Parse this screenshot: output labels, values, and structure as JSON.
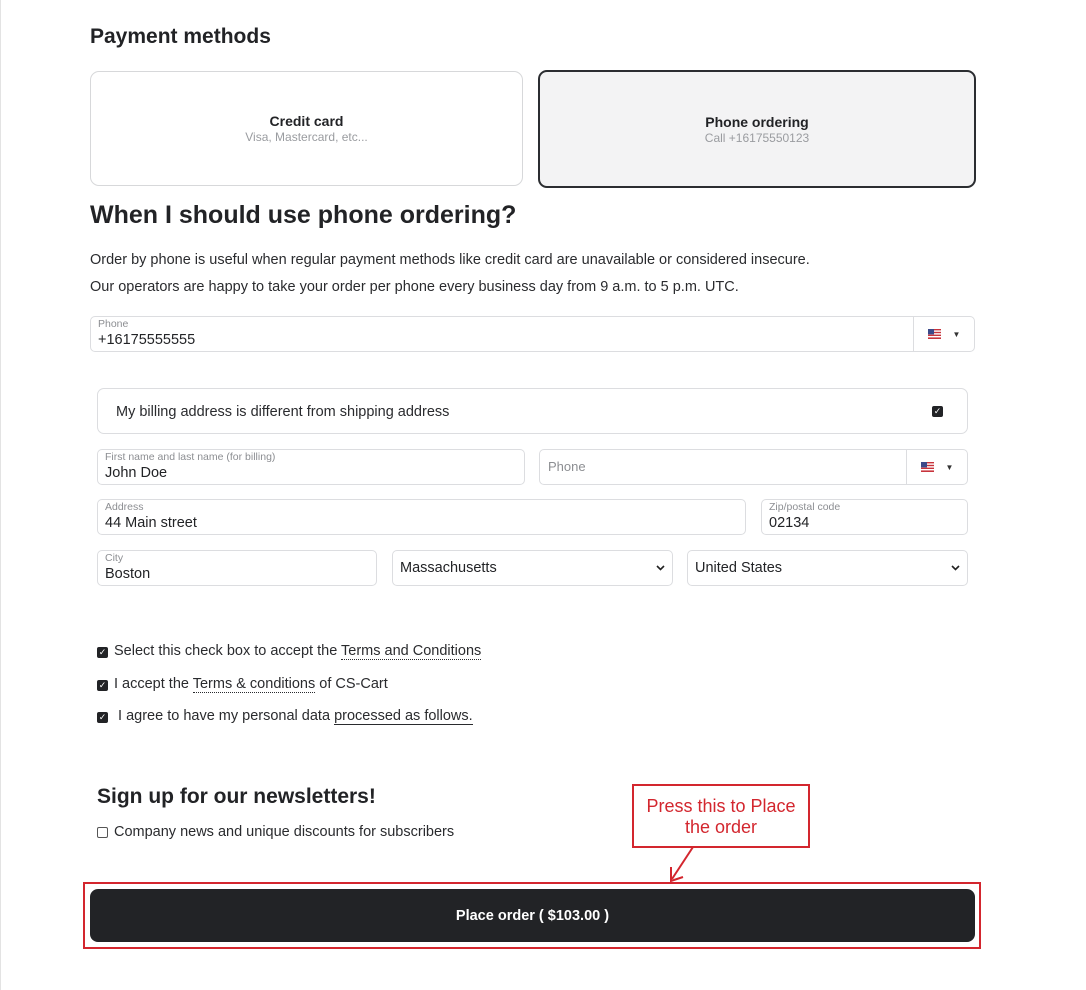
{
  "payment": {
    "heading": "Payment methods",
    "methods": [
      {
        "title": "Credit card",
        "subtitle": "Visa, Mastercard, etc...",
        "selected": false
      },
      {
        "title": "Phone ordering",
        "subtitle": "Call +16175550123",
        "selected": true
      }
    ]
  },
  "info": {
    "heading": "When I should use phone ordering?",
    "line1": "Order by phone is useful when regular payment methods like credit card are unavailable or considered insecure.",
    "line2": "Our operators are happy to take your order per phone every business day from 9 a.m. to 5 p.m. UTC."
  },
  "phone_field": {
    "label": "Phone",
    "value": "+16175555555",
    "country_icon": "us-flag-icon"
  },
  "billing": {
    "toggle_label": "My billing address is different from shipping address",
    "toggle_checked": true,
    "name": {
      "label": "First name and last name (for billing)",
      "value": "John Doe"
    },
    "phone": {
      "placeholder": "Phone",
      "country_icon": "us-flag-icon"
    },
    "address": {
      "label": "Address",
      "value": "44 Main street"
    },
    "zip": {
      "label": "Zip/postal code",
      "value": "02134"
    },
    "city": {
      "label": "City",
      "value": "Boston"
    },
    "state": {
      "value": "Massachusetts"
    },
    "country": {
      "value": "United States"
    }
  },
  "agreements": {
    "terms_prefix": "Select this check box to accept the ",
    "terms_link": "Terms and Conditions",
    "cscart_prefix": "I accept the ",
    "cscart_link": "Terms & conditions",
    "cscart_suffix": " of CS-Cart",
    "data_prefix": " I agree to have my personal data ",
    "data_link": "processed as follows."
  },
  "newsletter": {
    "heading": "Sign up for our newsletters!",
    "option": "Company news and unique discounts for subscribers",
    "checked": false
  },
  "place_order": {
    "label": "Place order ( $103.00 )"
  },
  "annotation": {
    "line1": "Press this to Place",
    "line2": "the order",
    "color": "#d3262e"
  },
  "colors": {
    "dark": "#222326",
    "border": "#dcdde0"
  }
}
